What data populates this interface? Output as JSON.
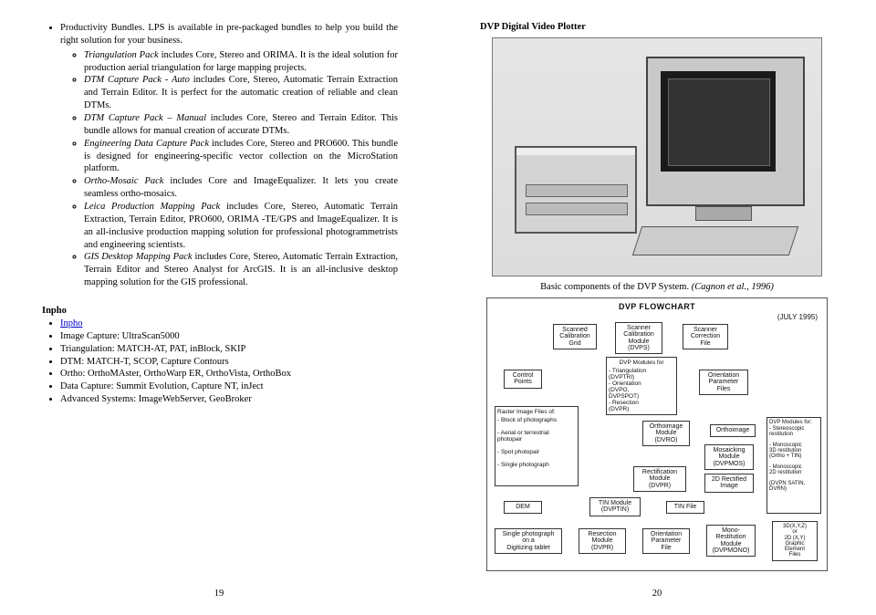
{
  "left": {
    "bundles_heading": "Productivity Bundles. LPS is available in pre-packaged bundles to help you build the right solution for your business.",
    "items": [
      {
        "lead": "Triangulation Pack",
        "rest": " includes Core, Stereo and ORIMA. It is the ideal solution for production aerial triangulation for large mapping projects."
      },
      {
        "lead": "DTM Capture Pack - Auto",
        "rest": " includes Core, Stereo, Automatic Terrain Extraction and Terrain Editor. It is perfect for the automatic creation of reliable and clean DTMs."
      },
      {
        "lead": "DTM Capture Pack – Manual",
        "rest": " includes Core, Stereo and Terrain Editor. This bundle allows for manual creation of accurate DTMs."
      },
      {
        "lead": "Engineering Data Capture Pack",
        "rest": " includes Core, Stereo and PRO600. This bundle is designed for engineering-specific vector collection on the MicroStation platform."
      },
      {
        "lead": "Ortho-Mosaic Pack",
        "rest": " includes Core and ImageEqualizer. It lets you create seamless ortho-mosaics."
      },
      {
        "lead": "Leica Production Mapping Pack",
        "rest": " includes Core, Stereo, Automatic Terrain Extraction, Terrain Editor, PRO600, ORIMA -TE/GPS and ImageEqualizer. It is an all-inclusive production mapping solution for professional photogrammetrists and engineering scientists."
      },
      {
        "lead": "GIS Desktop Mapping Pack",
        "rest": " includes Core, Stereo, Automatic Terrain Extraction, Terrain Editor and Stereo Analyst for ArcGIS. It is an all-inclusive desktop mapping solution for the GIS professional."
      }
    ],
    "inpho_heading": "Inpho",
    "inpho_link": "Inpho",
    "inpho_items": [
      "Image Capture: UltraScan5000",
      "Triangulation: MATCH-AT, PAT, inBlock, SKIP",
      "DTM: MATCH-T, SCOP, Capture Contours",
      "Ortho: OrthoMAster, OrthoWarp ER, OrthoVista, OrthoBox",
      "Data Capture: Summit Evolution, Capture NT, inJect",
      "Advanced Systems: ImageWebServer, GeoBroker"
    ],
    "page_number": "19"
  },
  "right": {
    "heading": "DVP Digital Video Plotter",
    "caption_plain": "Basic components of the DVP System. ",
    "caption_italic": "(Cagnon et al., 1996)",
    "flowchart": {
      "title": "DVP FLOWCHART",
      "date": "(JULY 1995)",
      "boxes": {
        "scg": "Scanned\nCalibration\nGrid",
        "scm": "Scanner\nCalibration\nModule\n(DVPS)",
        "scf": "Scanner\nCorrection\nFile",
        "cp": "Control\nPoints",
        "dvpmod": "DVP Modules for",
        "triang": "- Triangulation\n(DVPTRI)",
        "orient": "- Orientation\n(DVPO,\nDVPSPOT)",
        "resect": "- Resection\n(DVPR)",
        "opf": "Orientation\nParameter\nFiles",
        "raster_head": "Raster Image Files of:",
        "raster_items": "- Block of photographs\n\n- Aerial or terrestrial\n  photopair\n\n- Spot photopair\n\n- Single photograph",
        "ortho": "Orthoimage\nModule\n(DVRO)",
        "orthoimg": "Orthoimage",
        "rhs_head": "DVP Modules for:",
        "rhs_items": "- Stereoscopic\n  restitution\n\n- Monoscopic\n  3D restitution\n  (Ortho + TIN)\n\n- Monoscopic\n  2D restitution\n\n(DVPN SATIN,\nDVRN)",
        "mosaic": "Mosaicking\nModule\n(DVPMOS)",
        "rect": "Rectification\nModule\n(DVPR)",
        "rect2d": "2D Rectified\nImage",
        "dem": "DEM",
        "tinmod": "TIN Module\n(DVPTIN)",
        "tinfile": "TIN File",
        "single": "Single photograph\non a\nDigitizing tablet",
        "resmod": "Resection\nModule\n(DVPR)",
        "opf2": "Orientation\nParameter\nFile",
        "mono": "Mono-\nRestitution\nModule\n(DVPMONO)",
        "graph": "3D(X,Y,Z)\nor\n2D (X,Y)\nGraphic\nElement\nFiles"
      }
    },
    "page_number": "20"
  }
}
